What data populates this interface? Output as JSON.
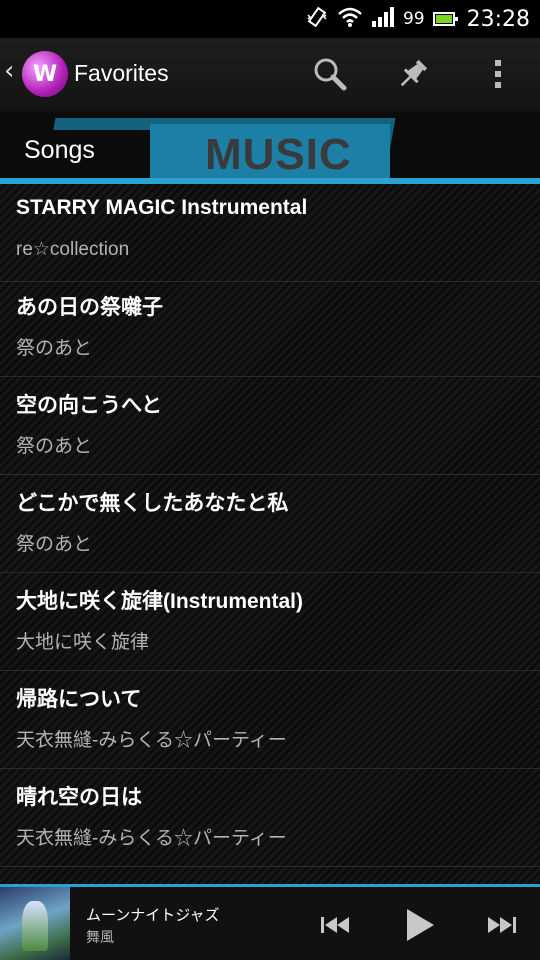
{
  "status_bar": {
    "battery_percent": "99",
    "time": "23:28",
    "icons": [
      "vibrate-icon",
      "wifi-icon",
      "signal-icon",
      "battery-icon"
    ]
  },
  "action_bar": {
    "back_glyph": "‹",
    "logo_letter": "W",
    "title": "Favorites",
    "icons": [
      "search-icon",
      "pin-icon",
      "overflow-menu-icon"
    ]
  },
  "banner": {
    "section_label": "Songs",
    "decor_text": "MUSIC",
    "accent_color": "#2aa1d2"
  },
  "songs": [
    {
      "title": "STARRY MAGIC Instrumental",
      "artist": "re☆collection"
    },
    {
      "title": "あの日の祭囃子",
      "artist": "祭のあと"
    },
    {
      "title": "空の向こうへと",
      "artist": "祭のあと"
    },
    {
      "title": "どこかで無くしたあなたと私",
      "artist": "祭のあと"
    },
    {
      "title": "大地に咲く旋律(Instrumental)",
      "artist": "大地に咲く旋律"
    },
    {
      "title": "帰路について",
      "artist": "天衣無縫-みらくる☆パーティー"
    },
    {
      "title": "晴れ空の日は",
      "artist": "天衣無縫-みらくる☆パーティー"
    }
  ],
  "now_playing": {
    "title": "ムーンナイトジャズ",
    "artist": "舞風",
    "controls": [
      "previous-icon",
      "play-icon",
      "next-icon"
    ]
  }
}
